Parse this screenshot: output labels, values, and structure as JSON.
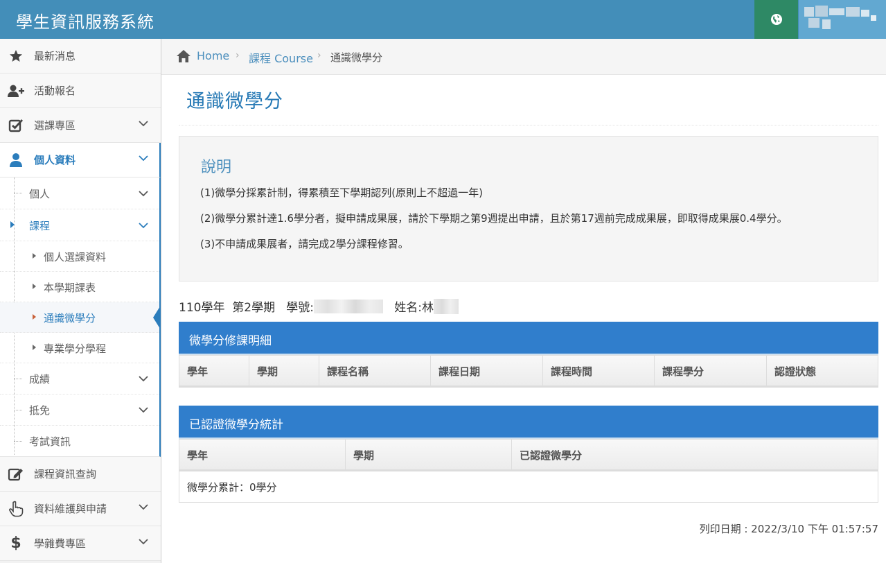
{
  "app": {
    "title": "學生資訊服務系統"
  },
  "sidebar": {
    "items": [
      {
        "label": "最新消息",
        "icon": "star-icon"
      },
      {
        "label": "活動報名",
        "icon": "user-plus-icon"
      },
      {
        "label": "選課專區",
        "icon": "check-square-icon"
      },
      {
        "label": "個人資料",
        "icon": "user-icon"
      },
      {
        "label": "課程資訊查詢",
        "icon": "edit-icon"
      },
      {
        "label": "資料維護與申請",
        "icon": "hand-pointer-icon"
      },
      {
        "label": "學雜費專區",
        "icon": "dollar-icon"
      }
    ],
    "submenu": [
      {
        "label": "個人"
      },
      {
        "label": "課程"
      },
      {
        "label": "成績"
      },
      {
        "label": "抵免"
      },
      {
        "label": "考試資訊"
      }
    ],
    "course_items": [
      {
        "label": "個人選課資料"
      },
      {
        "label": "本學期課表"
      },
      {
        "label": "通識微學分"
      },
      {
        "label": "專業學分學程"
      }
    ]
  },
  "breadcrumb": {
    "home": "Home",
    "course": "課程 Course",
    "current": "通識微學分"
  },
  "page": {
    "title": "通識微學分"
  },
  "info": {
    "title": "說明",
    "lines": [
      "(1)微學分採累計制，得累積至下學期認列(原則上不超過一年)",
      "(2)微學分累計達1.6學分者，擬申請成果展，請於下學期之第9週提出申請，且於第17週前完成成果展，即取得成果展0.4學分。",
      "(3)不申請成果展者，請完成2學分課程修習。"
    ]
  },
  "student": {
    "term": "110學年  第2學期",
    "id_label": "學號:",
    "name_label": "姓名:林"
  },
  "detail_table": {
    "title": "微學分修課明細",
    "columns": [
      "學年",
      "學期",
      "課程名稱",
      "課程日期",
      "課程時間",
      "課程學分",
      "認證狀態"
    ]
  },
  "stats_table": {
    "title": "已認證微學分統計",
    "columns": [
      "學年",
      "學期",
      "已認證微學分"
    ],
    "total": "微學分累計：0學分"
  },
  "footer": {
    "print_date": "列印日期 : 2022/3/10 下午 01:57:57"
  }
}
